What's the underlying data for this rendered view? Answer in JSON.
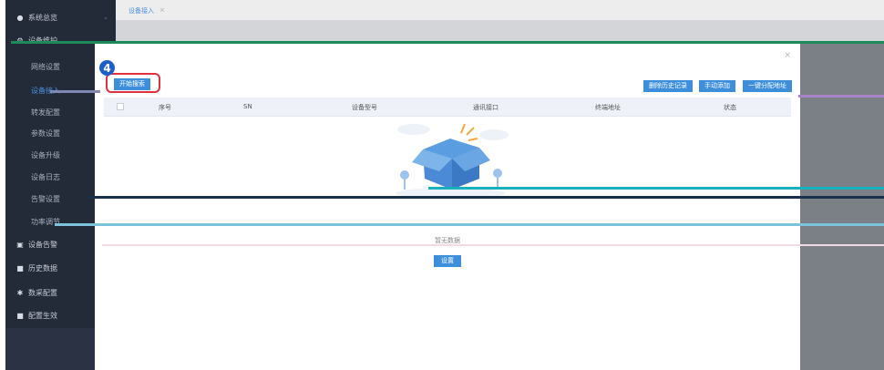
{
  "sidebar": {
    "items": [
      {
        "label": "系统总览",
        "icon": "dashboard-icon"
      },
      {
        "label": "设备维护",
        "icon": "settings-icon"
      },
      {
        "label": "网络设置"
      },
      {
        "label": "设备接入"
      },
      {
        "label": "转发配置"
      },
      {
        "label": "参数设置"
      },
      {
        "label": "设备升级"
      },
      {
        "label": "设备日志"
      },
      {
        "label": "告警设置"
      },
      {
        "label": "功率调节"
      },
      {
        "label": "设备告警",
        "icon": "shield-icon"
      },
      {
        "label": "历史数据",
        "icon": "history-icon"
      },
      {
        "label": "数采配置",
        "icon": "config-icon"
      },
      {
        "label": "配置生效",
        "icon": "apply-icon"
      }
    ]
  },
  "topbar": {
    "tab_label": "设备接入",
    "tab_close": "×"
  },
  "modal": {
    "close": "×",
    "step_number": "4",
    "buttons": {
      "search": "开始搜索",
      "clear_history": "删除历史记录",
      "manual_add": "手动添加",
      "auto_allocate": "一键分配地址",
      "setup": "设置"
    },
    "table": {
      "headers": [
        "序号",
        "SN",
        "设备型号",
        "通讯接口",
        "终端地址",
        "状态"
      ]
    },
    "empty_text": "暂无数据"
  },
  "colors": {
    "accent": "#3d8fdc",
    "sidebar_bg": "#232a38",
    "highlight_red": "#e0313e",
    "badge_blue": "#1d5fc8"
  }
}
